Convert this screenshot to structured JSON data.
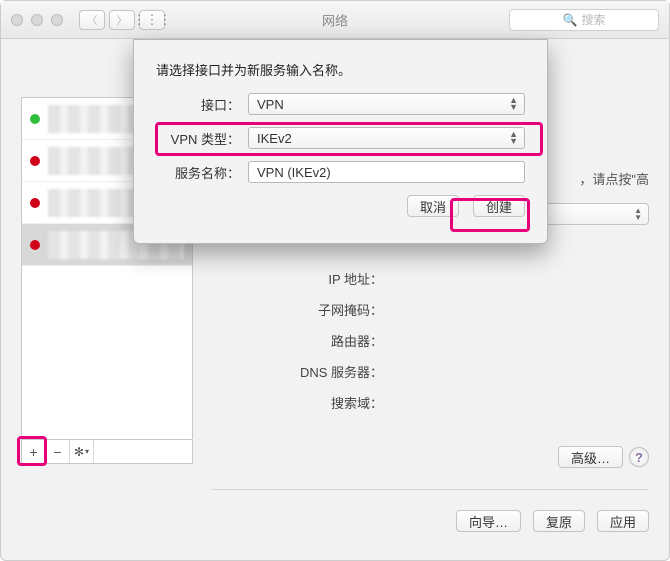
{
  "titlebar": {
    "title": "网络",
    "search_placeholder": "搜索"
  },
  "hint_text": "，请点按\"高",
  "fields": {
    "ip": "IP 地址：",
    "subnet": "子网掩码：",
    "router": "路由器：",
    "dns": "DNS 服务器：",
    "searchdom": "搜索域："
  },
  "buttons": {
    "advanced": "高级…",
    "assist": "向导…",
    "revert": "复原",
    "apply": "应用"
  },
  "sheet": {
    "message": "请选择接口并为新服务输入名称。",
    "interface_label": "接口：",
    "interface_value": "VPN",
    "vpntype_label": "VPN 类型：",
    "vpntype_value": "IKEv2",
    "servicename_label": "服务名称：",
    "servicename_value": "VPN (IKEv2)",
    "cancel": "取消",
    "create": "创建"
  }
}
